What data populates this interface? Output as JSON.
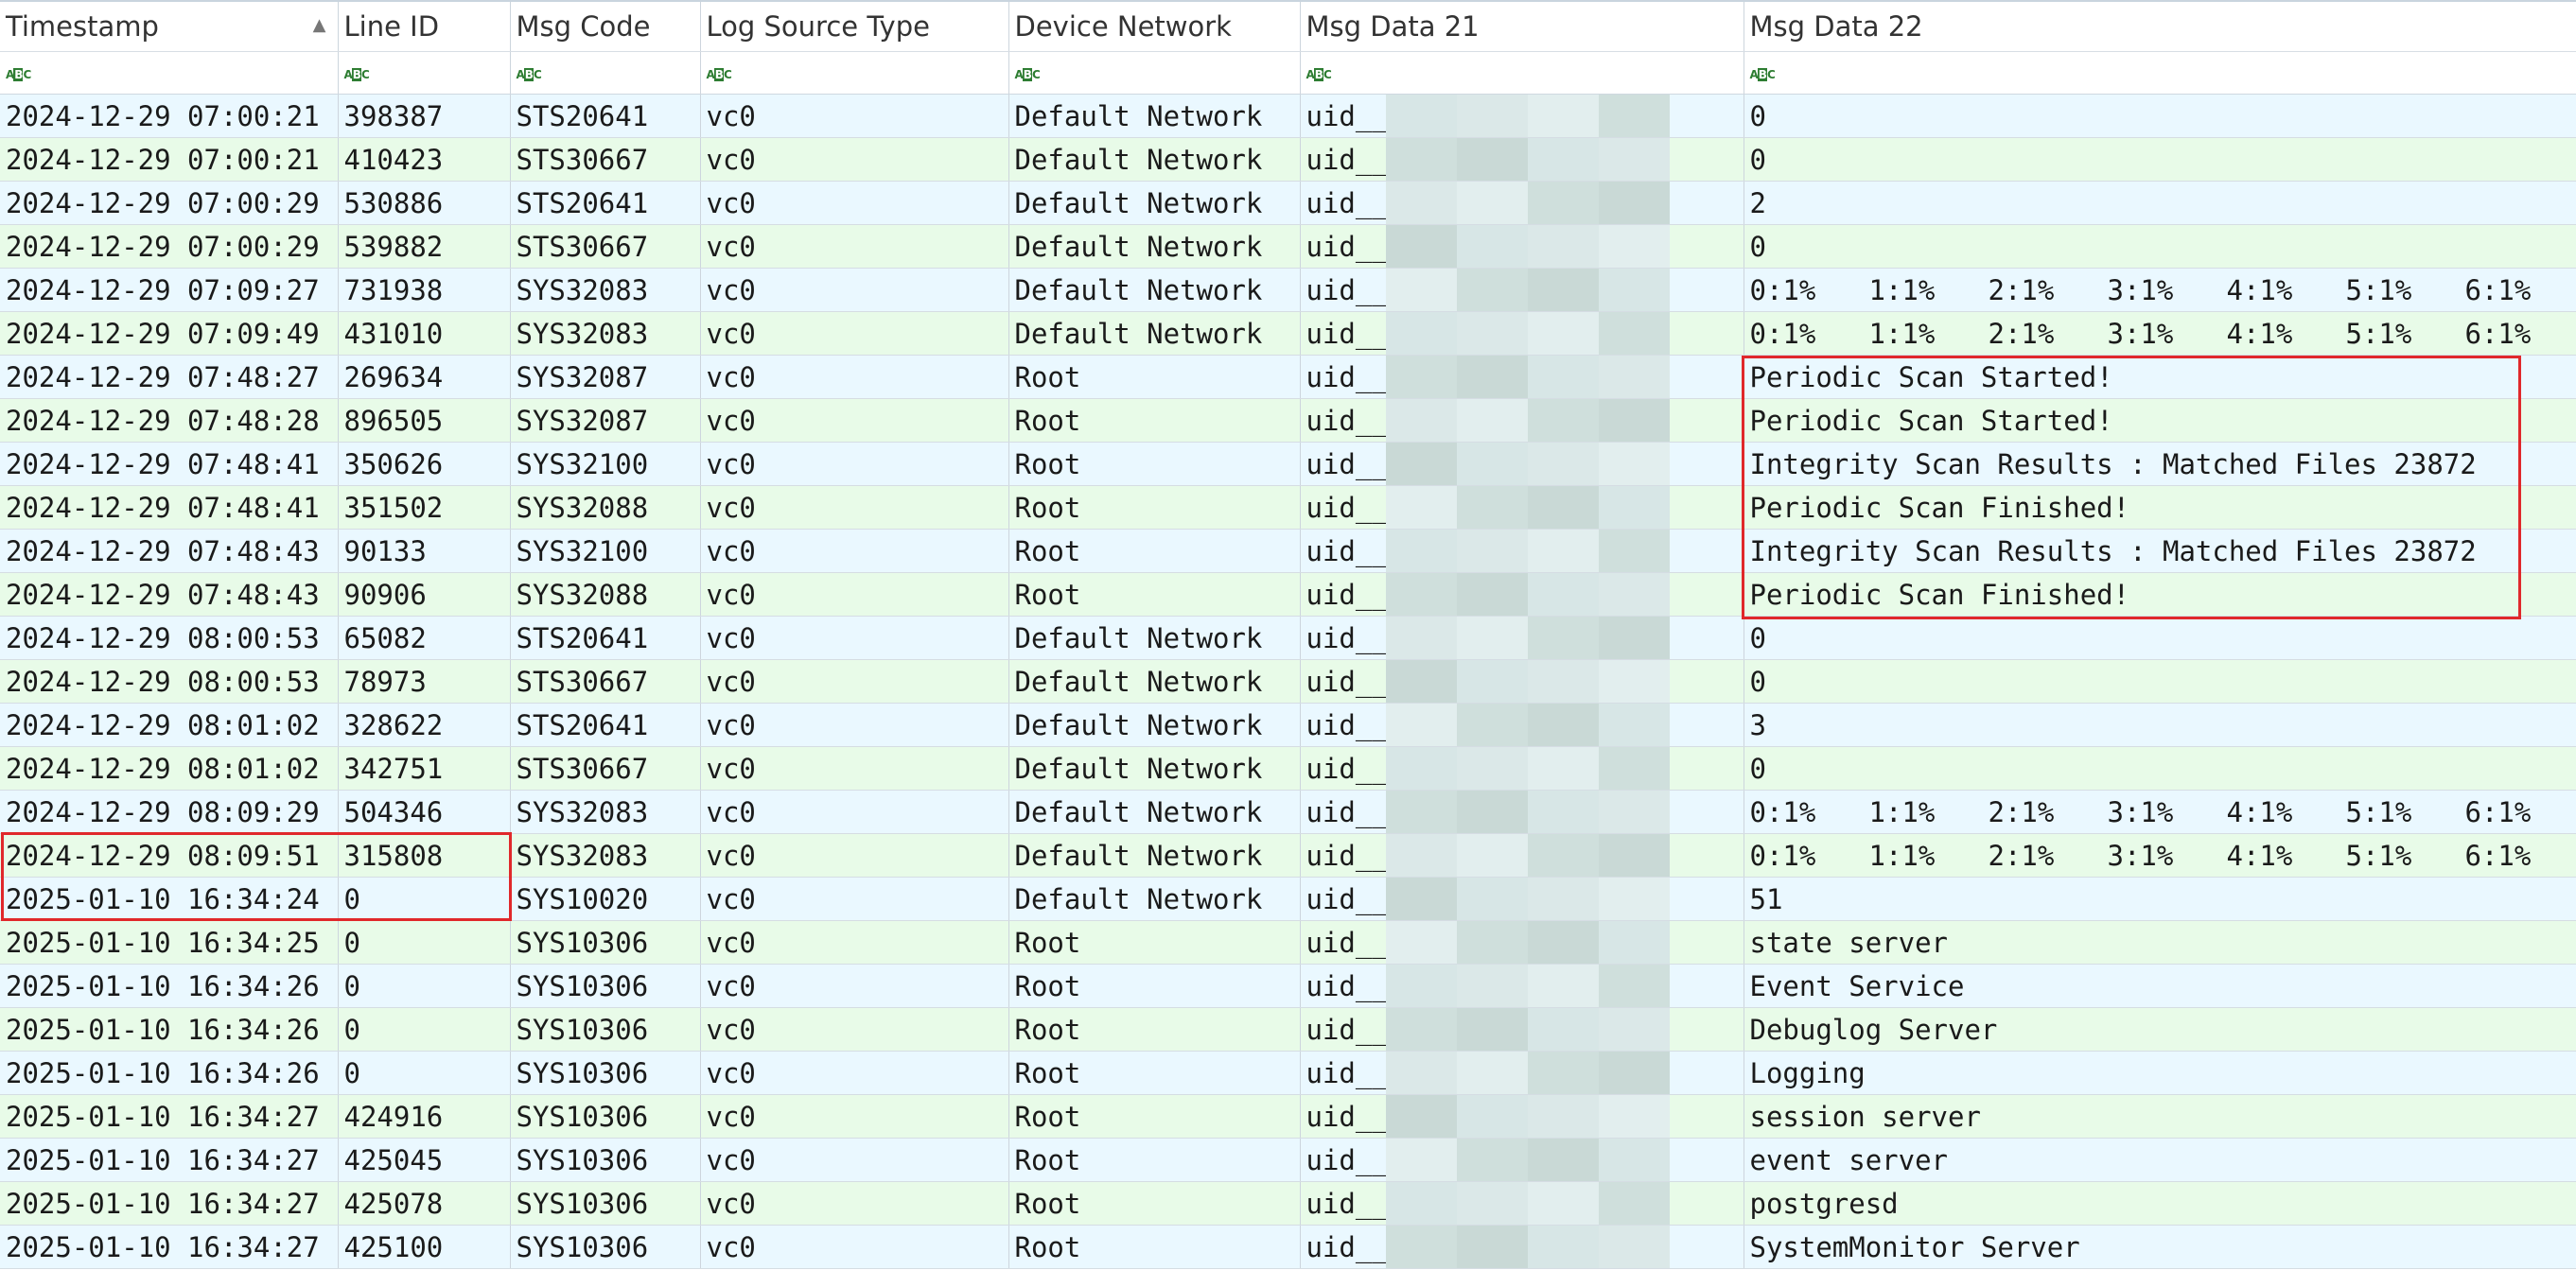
{
  "columns": [
    {
      "name": "Timestamp",
      "sorted": true
    },
    {
      "name": "Line ID"
    },
    {
      "name": "Msg Code"
    },
    {
      "name": "Log Source Type"
    },
    {
      "name": "Device Network"
    },
    {
      "name": "Msg Data 21"
    },
    {
      "name": "Msg Data 22"
    }
  ],
  "type_icon_label": "ABC",
  "cpu_values": [
    "0:1%",
    "1:1%",
    "2:1%",
    "3:1%",
    "4:1%",
    "5:1%",
    "6:1%"
  ],
  "rows": [
    {
      "ts": "2024-12-29 07:00:21",
      "line": "398387",
      "code": "STS20641",
      "src": "vc0",
      "net": "Default Network",
      "d21": "uid__",
      "d22": "0"
    },
    {
      "ts": "2024-12-29 07:00:21",
      "line": "410423",
      "code": "STS30667",
      "src": "vc0",
      "net": "Default Network",
      "d21": "uid__",
      "d22": "0"
    },
    {
      "ts": "2024-12-29 07:00:29",
      "line": "530886",
      "code": "STS20641",
      "src": "vc0",
      "net": "Default Network",
      "d21": "uid__",
      "d22": "2"
    },
    {
      "ts": "2024-12-29 07:00:29",
      "line": "539882",
      "code": "STS30667",
      "src": "vc0",
      "net": "Default Network",
      "d21": "uid__",
      "d22": "0"
    },
    {
      "ts": "2024-12-29 07:09:27",
      "line": "731938",
      "code": "SYS32083",
      "src": "vc0",
      "net": "Default Network",
      "d21": "uid__",
      "d22": "",
      "cpu": true
    },
    {
      "ts": "2024-12-29 07:09:49",
      "line": "431010",
      "code": "SYS32083",
      "src": "vc0",
      "net": "Default Network",
      "d21": "uid__",
      "d22": "",
      "cpu": true
    },
    {
      "ts": "2024-12-29 07:48:27",
      "line": "269634",
      "code": "SYS32087",
      "src": "vc0",
      "net": "Root",
      "d21": "uid__",
      "d22": "Periodic Scan Started!"
    },
    {
      "ts": "2024-12-29 07:48:28",
      "line": "896505",
      "code": "SYS32087",
      "src": "vc0",
      "net": "Root",
      "d21": "uid__",
      "d22": "Periodic Scan Started!"
    },
    {
      "ts": "2024-12-29 07:48:41",
      "line": "350626",
      "code": "SYS32100",
      "src": "vc0",
      "net": "Root",
      "d21": "uid__",
      "d22": "Integrity Scan Results : Matched Files 23872"
    },
    {
      "ts": "2024-12-29 07:48:41",
      "line": "351502",
      "code": "SYS32088",
      "src": "vc0",
      "net": "Root",
      "d21": "uid__",
      "d22": "Periodic Scan Finished!"
    },
    {
      "ts": "2024-12-29 07:48:43",
      "line": "90133",
      "code": "SYS32100",
      "src": "vc0",
      "net": "Root",
      "d21": "uid__",
      "d22": "Integrity Scan Results : Matched Files 23872"
    },
    {
      "ts": "2024-12-29 07:48:43",
      "line": "90906",
      "code": "SYS32088",
      "src": "vc0",
      "net": "Root",
      "d21": "uid__",
      "d22": "Periodic Scan Finished!"
    },
    {
      "ts": "2024-12-29 08:00:53",
      "line": "65082",
      "code": "STS20641",
      "src": "vc0",
      "net": "Default Network",
      "d21": "uid__",
      "d22": "0"
    },
    {
      "ts": "2024-12-29 08:00:53",
      "line": "78973",
      "code": "STS30667",
      "src": "vc0",
      "net": "Default Network",
      "d21": "uid__",
      "d22": "0"
    },
    {
      "ts": "2024-12-29 08:01:02",
      "line": "328622",
      "code": "STS20641",
      "src": "vc0",
      "net": "Default Network",
      "d21": "uid__",
      "d22": "3"
    },
    {
      "ts": "2024-12-29 08:01:02",
      "line": "342751",
      "code": "STS30667",
      "src": "vc0",
      "net": "Default Network",
      "d21": "uid__",
      "d22": "0"
    },
    {
      "ts": "2024-12-29 08:09:29",
      "line": "504346",
      "code": "SYS32083",
      "src": "vc0",
      "net": "Default Network",
      "d21": "uid__",
      "d22": "",
      "cpu": true
    },
    {
      "ts": "2024-12-29 08:09:51",
      "line": "315808",
      "code": "SYS32083",
      "src": "vc0",
      "net": "Default Network",
      "d21": "uid__",
      "d22": "",
      "cpu": true
    },
    {
      "ts": "2025-01-10 16:34:24",
      "line": "0",
      "code": "SYS10020",
      "src": "vc0",
      "net": "Default Network",
      "d21": "uid__",
      "d22": "51"
    },
    {
      "ts": "2025-01-10 16:34:25",
      "line": "0",
      "code": "SYS10306",
      "src": "vc0",
      "net": "Root",
      "d21": "uid__",
      "d22": "state server"
    },
    {
      "ts": "2025-01-10 16:34:26",
      "line": "0",
      "code": "SYS10306",
      "src": "vc0",
      "net": "Root",
      "d21": "uid__",
      "d22": "Event Service"
    },
    {
      "ts": "2025-01-10 16:34:26",
      "line": "0",
      "code": "SYS10306",
      "src": "vc0",
      "net": "Root",
      "d21": "uid__",
      "d22": "Debuglog Server"
    },
    {
      "ts": "2025-01-10 16:34:26",
      "line": "0",
      "code": "SYS10306",
      "src": "vc0",
      "net": "Root",
      "d21": "uid__",
      "d22": "Logging"
    },
    {
      "ts": "2025-01-10 16:34:27",
      "line": "424916",
      "code": "SYS10306",
      "src": "vc0",
      "net": "Root",
      "d21": "uid__",
      "d22": "session server"
    },
    {
      "ts": "2025-01-10 16:34:27",
      "line": "425045",
      "code": "SYS10306",
      "src": "vc0",
      "net": "Root",
      "d21": "uid__",
      "d22": "event server"
    },
    {
      "ts": "2025-01-10 16:34:27",
      "line": "425078",
      "code": "SYS10306",
      "src": "vc0",
      "net": "Root",
      "d21": "uid__",
      "d22": "postgresd"
    },
    {
      "ts": "2025-01-10 16:34:27",
      "line": "425100",
      "code": "SYS10306",
      "src": "vc0",
      "net": "Root",
      "d21": "uid__",
      "d22": "SystemMonitor Server"
    }
  ],
  "colors": {
    "odd_row": "#eaf8ff",
    "even_row": "#e8fbe8",
    "highlight_border": "#e0282b",
    "mosaic_tones": [
      "#d7e6e6",
      "#cfdfdc",
      "#dbe8e8",
      "#c9d9d6",
      "#e2eeee"
    ]
  },
  "highlights": [
    "msg-data-22 rows 7-12",
    "timestamp+line-id rows 18-19"
  ]
}
